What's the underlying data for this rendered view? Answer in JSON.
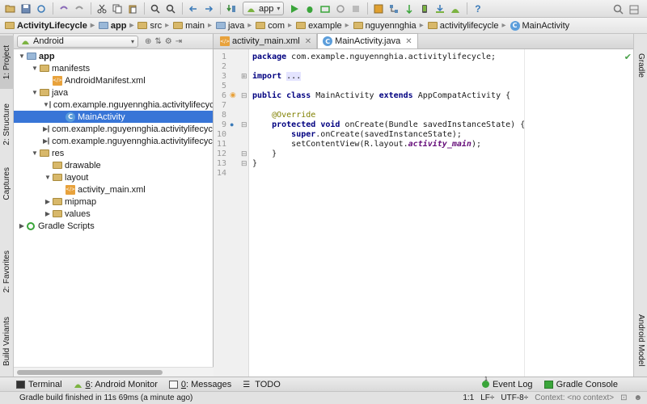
{
  "toolbar": {
    "run_config": "app",
    "icons": [
      "open-icon",
      "save-icon",
      "sync-icon",
      "undo-icon",
      "redo-icon",
      "cut-icon",
      "copy-icon",
      "paste-icon",
      "find-icon",
      "replace-icon",
      "back-icon",
      "forward-icon",
      "make-icon",
      "run-icon",
      "debug-icon",
      "attach-icon",
      "stop-icon",
      "profile-icon",
      "sdk-icon",
      "avd-icon",
      "help-icon",
      "search-icon"
    ]
  },
  "breadcrumb": [
    "ActivityLifecycle",
    "app",
    "src",
    "main",
    "java",
    "com",
    "example",
    "nguyennghia",
    "activitylifecycle",
    "MainActivity"
  ],
  "left_tabs": {
    "project": "1: Project",
    "structure": "2: Structure",
    "captures": "Captures",
    "favorites": "2: Favorites",
    "build_variants": "Build Variants"
  },
  "right_tabs": {
    "gradle": "Gradle",
    "android_model": "Android Model"
  },
  "project": {
    "view_mode": "Android",
    "tree": [
      {
        "label": "app",
        "depth": 0,
        "expanded": true,
        "icon": "module",
        "bold": true
      },
      {
        "label": "manifests",
        "depth": 1,
        "expanded": true,
        "icon": "folder"
      },
      {
        "label": "AndroidManifest.xml",
        "depth": 2,
        "icon": "xml"
      },
      {
        "label": "java",
        "depth": 1,
        "expanded": true,
        "icon": "folder"
      },
      {
        "label": "com.example.nguyennghia.activitylifecycle",
        "depth": 2,
        "expanded": true,
        "icon": "package"
      },
      {
        "label": "MainActivity",
        "depth": 3,
        "icon": "class",
        "selected": true
      },
      {
        "label": "com.example.nguyennghia.activitylifecycle",
        "depth": 2,
        "expanded": false,
        "icon": "package"
      },
      {
        "label": "com.example.nguyennghia.activitylifecycle",
        "depth": 2,
        "expanded": false,
        "icon": "package"
      },
      {
        "label": "res",
        "depth": 1,
        "expanded": true,
        "icon": "folder"
      },
      {
        "label": "drawable",
        "depth": 2,
        "icon": "folder"
      },
      {
        "label": "layout",
        "depth": 2,
        "expanded": true,
        "icon": "folder"
      },
      {
        "label": "activity_main.xml",
        "depth": 3,
        "icon": "xml"
      },
      {
        "label": "mipmap",
        "depth": 2,
        "expanded": false,
        "icon": "folder"
      },
      {
        "label": "values",
        "depth": 2,
        "expanded": false,
        "icon": "folder"
      },
      {
        "label": "Gradle Scripts",
        "depth": 0,
        "expanded": false,
        "icon": "gradle"
      }
    ]
  },
  "editor": {
    "tabs": [
      {
        "label": "activity_main.xml",
        "icon": "xml",
        "active": false
      },
      {
        "label": "MainActivity.java",
        "icon": "class",
        "active": true
      }
    ],
    "line_numbers": [
      "1",
      "2",
      "3",
      "5",
      "6",
      "7",
      "8",
      "9",
      "10",
      "11",
      "12",
      "13",
      "14"
    ],
    "lines": [
      [
        {
          "t": "package",
          "c": "kw"
        },
        {
          "t": " com.example.nguyennghia.activitylifecycle;"
        }
      ],
      [],
      [
        {
          "t": "import",
          "c": "kw"
        },
        {
          "t": " "
        },
        {
          "t": "...",
          "c": "fold"
        }
      ],
      [],
      [
        {
          "t": "public",
          "c": "kw"
        },
        {
          "t": " "
        },
        {
          "t": "class",
          "c": "kw"
        },
        {
          "t": " MainActivity "
        },
        {
          "t": "extends",
          "c": "kw"
        },
        {
          "t": " AppCompatActivity {"
        }
      ],
      [],
      [
        {
          "t": "    "
        },
        {
          "t": "@Override",
          "c": "ann"
        }
      ],
      [
        {
          "t": "    "
        },
        {
          "t": "protected",
          "c": "kw"
        },
        {
          "t": " "
        },
        {
          "t": "void",
          "c": "kw"
        },
        {
          "t": " onCreate(Bundle savedInstanceState) {"
        }
      ],
      [
        {
          "t": "        "
        },
        {
          "t": "super",
          "c": "kw"
        },
        {
          "t": ".onCreate(savedInstanceState);"
        }
      ],
      [
        {
          "t": "        setContentView(R.layout."
        },
        {
          "t": "activity_main",
          "c": "fld"
        },
        {
          "t": ");"
        }
      ],
      [
        {
          "t": "    }"
        }
      ],
      [
        {
          "t": "}"
        }
      ],
      []
    ]
  },
  "bottom_tools": {
    "terminal": "Terminal",
    "android_monitor_num": "6",
    "android_monitor": ": Android Monitor",
    "messages_num": "0",
    "messages": ": Messages",
    "todo": "TODO",
    "event_log": "Event Log",
    "event_log_count": "1",
    "gradle_console": "Gradle Console"
  },
  "status": {
    "message": "Gradle build finished in 11s 69ms (a minute ago)",
    "position": "1:1",
    "line_sep": "LF÷",
    "encoding": "UTF-8÷",
    "context": "Context: <no context>"
  },
  "colors": {
    "accent": "#3875d7",
    "keyword": "#000080",
    "annotation": "#808000",
    "field": "#660e7a"
  }
}
